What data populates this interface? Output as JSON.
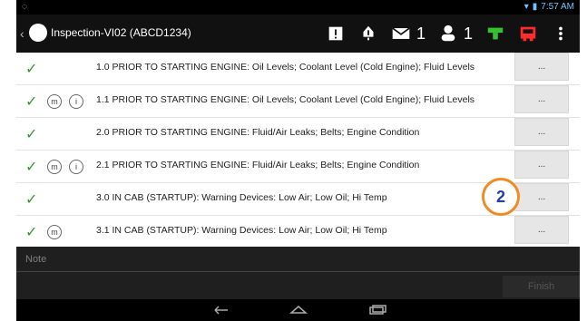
{
  "status_bar": {
    "time": "7:57 AM"
  },
  "app_bar": {
    "title": "Inspection-VI02 (ABCD1234)",
    "messages_count": "1",
    "users_count": "1",
    "colors": {
      "green": "#35c12e",
      "red": "#ff2a2a"
    }
  },
  "rows": [
    {
      "text": "1.0 PRIOR TO STARTING ENGINE: Oil Levels; Coolant Level (Cold Engine); Fluid Levels",
      "m": "",
      "i": "",
      "more": "..."
    },
    {
      "text": "1.1 PRIOR TO STARTING ENGINE: Oil Levels; Coolant Level (Cold Engine); Fluid Levels",
      "m": "m",
      "i": "i",
      "more": "..."
    },
    {
      "text": "2.0 PRIOR TO STARTING ENGINE: Fluid/Air Leaks; Belts; Engine Condition",
      "m": "",
      "i": "",
      "more": "..."
    },
    {
      "text": "2.1 PRIOR TO STARTING ENGINE: Fluid/Air Leaks; Belts; Engine Condition",
      "m": "m",
      "i": "i",
      "more": "..."
    },
    {
      "text": "3.0 IN CAB (STARTUP): Warning Devices: Low Air; Low Oil; Hi Temp",
      "m": "",
      "i": "",
      "more": "..."
    },
    {
      "text": "3.1 IN CAB (STARTUP): Warning Devices: Low Air; Low Oil; Hi Temp",
      "m": "m",
      "i": "",
      "more": "..."
    }
  ],
  "callout": {
    "number": "2"
  },
  "note": {
    "placeholder": "Note"
  },
  "finish": {
    "label": "Finish"
  }
}
